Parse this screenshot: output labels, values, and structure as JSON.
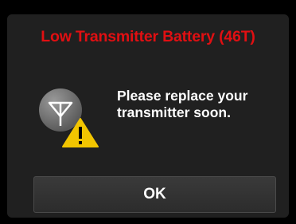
{
  "alert": {
    "title": "Low Transmitter Battery (46T)",
    "message_line1": "Please replace your",
    "message_line2": "transmitter soon.",
    "icon": "transmitter-warning-icon",
    "ok_label": "OK"
  },
  "colors": {
    "title": "#e10f12",
    "background": "#202020",
    "warning": "#f2c500"
  }
}
